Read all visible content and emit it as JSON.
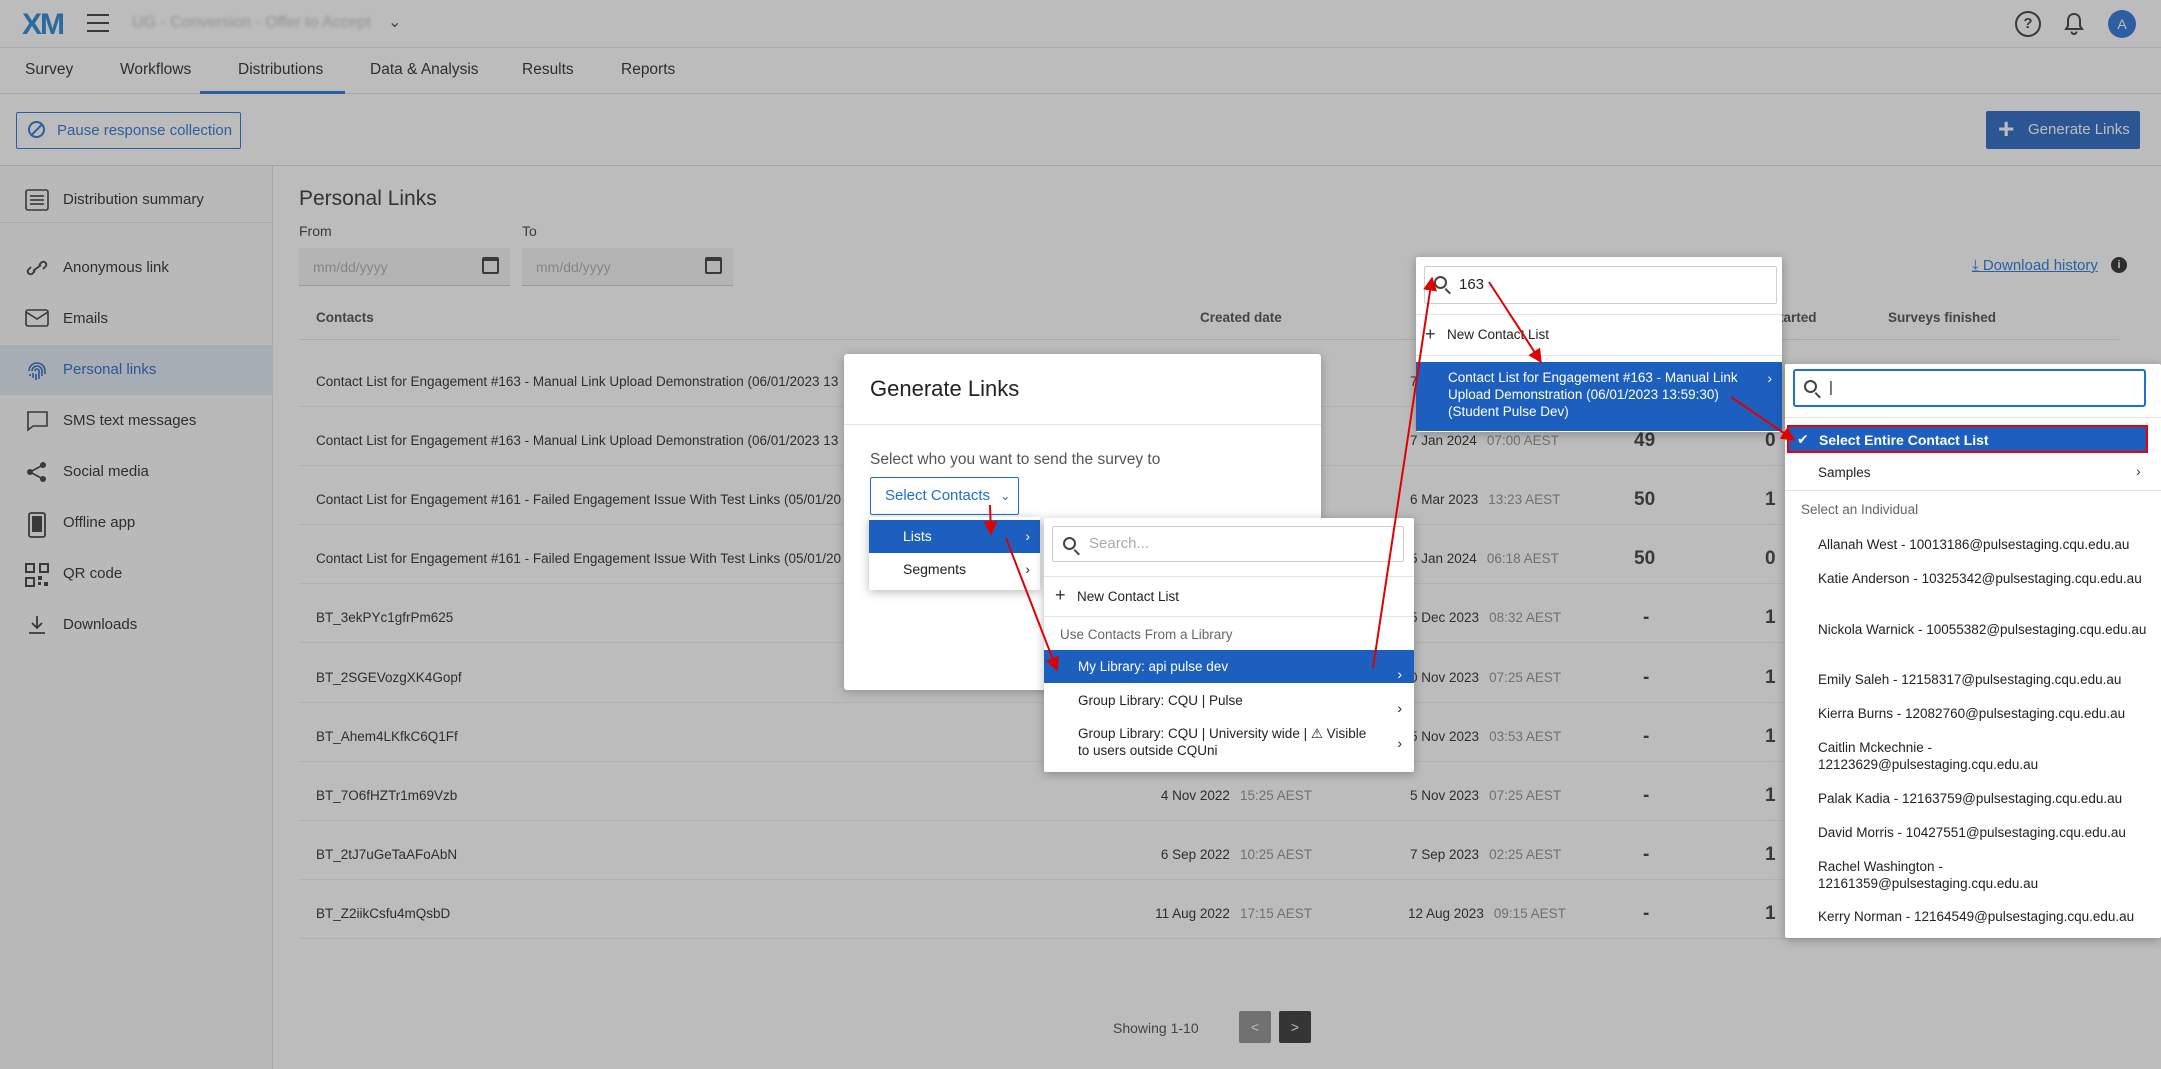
{
  "header": {
    "logo": "XM",
    "project_title": "UG - Conversion - Offer to Accept",
    "avatar_initial": "A",
    "help_glyph": "?"
  },
  "tabs": [
    "Survey",
    "Workflows",
    "Distributions",
    "Data & Analysis",
    "Results",
    "Reports"
  ],
  "active_tab": "Distributions",
  "toolbar": {
    "pause_label": "Pause response collection",
    "generate_label": "Generate Links"
  },
  "sidebar": {
    "items": [
      {
        "label": "Distribution summary",
        "icon": "list-icon"
      },
      {
        "label": "Anonymous link",
        "icon": "link-icon"
      },
      {
        "label": "Emails",
        "icon": "mail-icon"
      },
      {
        "label": "Personal links",
        "icon": "fingerprint-icon",
        "active": true
      },
      {
        "label": "SMS text messages",
        "icon": "chat-icon"
      },
      {
        "label": "Social media",
        "icon": "share-icon"
      },
      {
        "label": "Offline app",
        "icon": "tablet-icon"
      },
      {
        "label": "QR code",
        "icon": "qr-icon"
      },
      {
        "label": "Downloads",
        "icon": "download-icon"
      }
    ]
  },
  "main": {
    "heading": "Personal Links",
    "from_label": "From",
    "to_label": "To",
    "date_placeholder": "mm/dd/yyyy",
    "download_history": "Download history",
    "columns": {
      "contacts": "Contacts",
      "created": "Created date",
      "started": "tarted",
      "finished": "Surveys finished"
    },
    "rows": [
      {
        "name": "Contact List for Engagement #163 - Manual Link Upload Demonstration (06/01/2023 13",
        "created_date": "",
        "created_time": "",
        "sent_date": "7",
        "sent_time": "",
        "started": "",
        "finished": ""
      },
      {
        "name": "Contact List for Engagement #163 - Manual Link Upload Demonstration (06/01/2023 13",
        "created_date": "",
        "created_time": "",
        "sent_date": "7 Jan 2024",
        "sent_time": "07:00 AEST",
        "started": "49",
        "finished": "0"
      },
      {
        "name": "Contact List for Engagement #161 - Failed Engagement Issue With Test Links (05/01/20",
        "created_date": "",
        "created_time": "",
        "sent_date": "6 Mar 2023",
        "sent_time": "13:23 AEST",
        "started": "50",
        "finished": "1"
      },
      {
        "name": "Contact List for Engagement #161 - Failed Engagement Issue With Test Links (05/01/20",
        "created_date": "",
        "created_time": "",
        "sent_date": "5 Jan 2024",
        "sent_time": "06:18 AEST",
        "started": "50",
        "finished": "0"
      },
      {
        "name": "BT_3ekPYc1gfrPm625",
        "created_date": "",
        "created_time": "",
        "sent_date": "5 Dec 2023",
        "sent_time": "08:32 AEST",
        "started": "-",
        "finished": "1"
      },
      {
        "name": "BT_2SGEVozgXK4Gopf",
        "created_date": "",
        "created_time": "",
        "sent_date": "0 Nov 2023",
        "sent_time": "07:25 AEST",
        "started": "-",
        "finished": "1"
      },
      {
        "name": "BT_Ahem4LKfkC6Q1Ff",
        "created_date": "",
        "created_time": "",
        "sent_date": "5 Nov 2023",
        "sent_time": "03:53 AEST",
        "started": "-",
        "finished": "1"
      },
      {
        "name": "BT_7O6fHZTr1m69Vzb",
        "created_date": "4 Nov 2022",
        "created_time": "15:25 AEST",
        "sent_date": "5 Nov 2023",
        "sent_time": "07:25 AEST",
        "started": "-",
        "finished": "1"
      },
      {
        "name": "BT_2tJ7uGeTaAFoAbN",
        "created_date": "6 Sep 2022",
        "created_time": "10:25 AEST",
        "sent_date": "7 Sep 2023",
        "sent_time": "02:25 AEST",
        "started": "-",
        "finished": "1"
      },
      {
        "name": "BT_Z2iikCsfu4mQsbD",
        "created_date": "11 Aug 2022",
        "created_time": "17:15 AEST",
        "sent_date": "12 Aug 2023",
        "sent_time": "09:15 AEST",
        "started": "-",
        "finished": "1"
      }
    ],
    "pagination": {
      "text": "Showing 1-10",
      "prev": "<",
      "next": ">"
    }
  },
  "modal": {
    "title": "Generate Links",
    "prompt": "Select who you want to send the survey to",
    "select_label": "Select Contacts"
  },
  "menu_lists": {
    "items": [
      "Lists",
      "Segments"
    ]
  },
  "menu_library": {
    "search_placeholder": "Search...",
    "new_list": "New Contact List",
    "section_header": "Use Contacts From a Library",
    "libraries": [
      "My Library: api pulse dev",
      "Group Library: CQU | Pulse",
      "Group Library: CQU | University wide | ⚠ Visible to users outside CQUni"
    ]
  },
  "menu_contacts": {
    "search_value": "163",
    "new_list": "New Contact List",
    "selected_list": "Contact List for Engagement #163 - Manual Link Upload Demonstration (06/01/2023 13:59:30) (Student Pulse Dev)"
  },
  "menu_individuals": {
    "search_value": "|",
    "select_entire": "Select Entire Contact List",
    "samples": "Samples",
    "header": "Select an Individual",
    "individuals": [
      "Allanah West - 10013186@pulsestaging.cqu.edu.au",
      "Katie Anderson - 10325342@pulsestaging.cqu.edu.au",
      "Nickola Warnick - 10055382@pulsestaging.cqu.edu.au",
      "Emily Saleh - 12158317@pulsestaging.cqu.edu.au",
      "Kierra Burns - 12082760@pulsestaging.cqu.edu.au",
      "Caitlin Mckechnie - 12123629@pulsestaging.cqu.edu.au",
      "Palak Kadia - 12163759@pulsestaging.cqu.edu.au",
      "David Morris - 10427551@pulsestaging.cqu.edu.au",
      "Rachel Washington - 12161359@pulsestaging.cqu.edu.au",
      "Kerry Norman - 12164549@pulsestaging.cqu.edu.au"
    ]
  },
  "colors": {
    "accent": "#1d5fbf",
    "link": "#1d6ed6",
    "annotation": "#e00000"
  }
}
